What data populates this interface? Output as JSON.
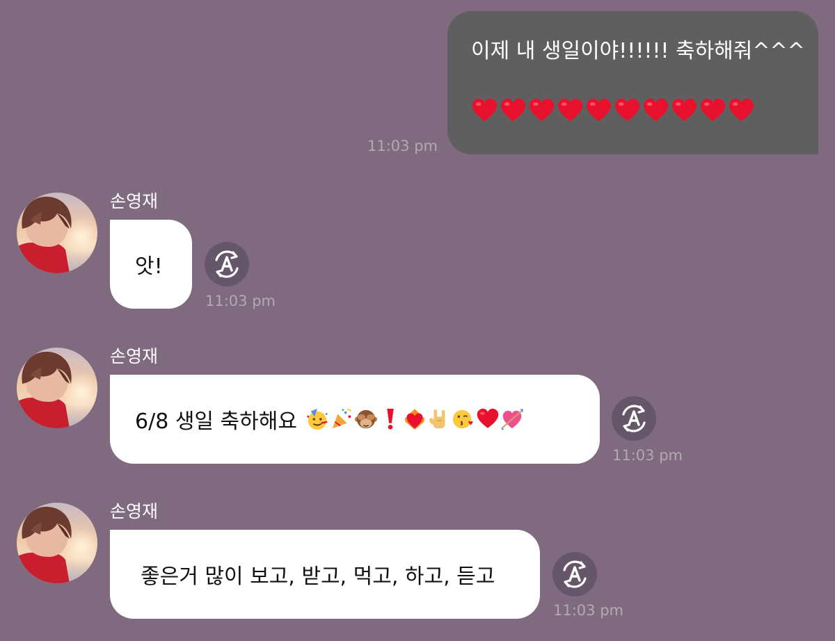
{
  "sent_message": {
    "text": "이제 내 생일이야!!!!!! 축하해줘^^^",
    "hearts": [
      "red-heart-icon",
      "red-heart-icon",
      "red-heart-icon",
      "red-heart-icon",
      "red-heart-icon",
      "red-heart-icon",
      "red-heart-icon",
      "red-heart-icon",
      "red-heart-icon",
      "red-heart-icon"
    ],
    "time": "11:03 pm"
  },
  "received_messages": [
    {
      "sender": "손영재",
      "text": "앗!",
      "time": "11:03 pm"
    },
    {
      "sender": "손영재",
      "text": "6/8 생일 축하해요",
      "emojis": [
        "partying-face-icon",
        "party-popper-icon",
        "see-no-evil-monkey-icon",
        "exclamation-mark-icon",
        "heart-on-fire-icon",
        "love-you-gesture-icon",
        "face-blowing-kiss-icon",
        "red-heart-icon",
        "heart-with-arrow-icon"
      ],
      "time": "11:03 pm"
    },
    {
      "sender": "손영재",
      "text": "좋은거 많이 보고, 받고, 먹고, 하고, 듣고",
      "time": "11:03 pm"
    }
  ],
  "icons": {
    "translate": "translate-icon"
  },
  "colors": {
    "background": "#7f6a80",
    "sent_bubble": "#5f5f5f",
    "received_bubble": "#ffffff",
    "timestamp": "#b3a8b6"
  }
}
